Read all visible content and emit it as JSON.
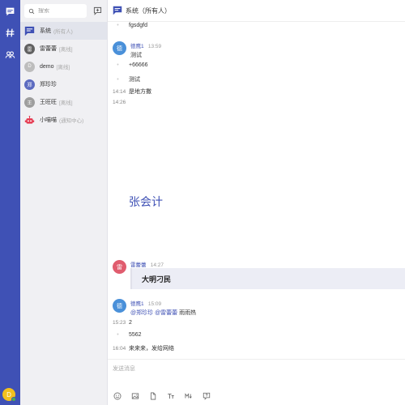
{
  "rail": {
    "avatar_initial": "D"
  },
  "sidebar": {
    "search_placeholder": "搜索",
    "conversations": [
      {
        "name": "系统",
        "tag": "(所有人)",
        "avatar": "",
        "avatar_color": "#3f51b5",
        "icon": "chat-bubble-icon"
      },
      {
        "name": "雷蕾蕾",
        "tag": "[离线]",
        "avatar": "雷",
        "avatar_color": "#616161"
      },
      {
        "name": "demo",
        "tag": "[离线]",
        "avatar": "D",
        "avatar_color": "#bdbdbd"
      },
      {
        "name": "郑珍珍",
        "tag": "",
        "avatar": "郑",
        "avatar_color": "#5c6bc0"
      },
      {
        "name": "王旺旺",
        "tag": "[离线]",
        "avatar": "王",
        "avatar_color": "#9e9e9e"
      },
      {
        "name": "小喵喵",
        "tag": "(通知中心)",
        "avatar": "",
        "avatar_color": "#e53950",
        "icon": "robot-icon"
      }
    ]
  },
  "header": {
    "title": "系统（所有人）"
  },
  "messages": {
    "m1_text": "fgsdgfd",
    "m2_nick": "德鹰1",
    "m2_time": "13:59",
    "m2_text": "测试",
    "m3_text": "+66666",
    "m4_text": "测试",
    "m5_time": "14:14",
    "m5_text": "是地方撒",
    "m6_time": "14:26",
    "big_text": "张会计",
    "m7_nick": "雷蕾蕾",
    "m7_time": "14:27",
    "m7_avatar": "雷",
    "card_text": "大明刁民",
    "m8_nick": "德鹰1",
    "m8_time": "15:09",
    "m8_avatar": "德",
    "m8_mention1": "@郑珍珍",
    "m8_mention2": "@雷蕾蕾",
    "m8_text": "雨雨热",
    "m2_avatar": "德",
    "m9_time": "15:23",
    "m9_text": "2",
    "m10_text": "5562",
    "m11_time": "16:04",
    "m11_text": "来来来，发给网络"
  },
  "composer": {
    "placeholder": "发送消息"
  },
  "colors": {
    "accent": "#3f51b5",
    "de_avatar": "#4a90d9",
    "lei_avatar": "#e05c6e"
  }
}
